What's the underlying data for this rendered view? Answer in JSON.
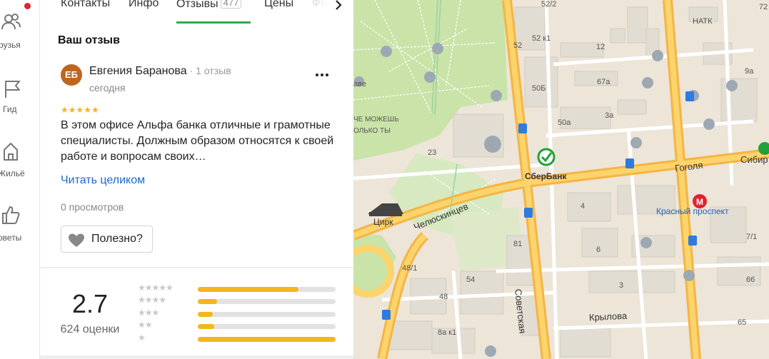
{
  "sidebar": {
    "items": [
      {
        "label": "рузья",
        "icon": "friends-icon",
        "has_notification": true
      },
      {
        "label": "Гид",
        "icon": "flag-icon"
      },
      {
        "label": "Жильё",
        "icon": "house-icon"
      },
      {
        "label": "оветы",
        "icon": "thumbs-up-icon"
      }
    ]
  },
  "tabs": [
    {
      "label": "Контакты"
    },
    {
      "label": "Инфо"
    },
    {
      "label": "Отзывы",
      "count": "477",
      "active": true
    },
    {
      "label": "Цены"
    },
    {
      "label": "Фо"
    }
  ],
  "your_review": {
    "section_title": "Ваш отзыв",
    "avatar_initials": "ЕБ",
    "author": "Евгения Баранова",
    "author_meta": "· 1 отзыв",
    "date": "сегодня",
    "stars": "★★★★★",
    "rating": 5,
    "text": "В этом офисе Альфа банка отличные и грамотные специалисты. Должным образом относятся к своей работе и вопросам своих…",
    "read_more": "Читать целиком",
    "views": "0 просмотров",
    "useful_label": "Полезно?"
  },
  "summary": {
    "rating": "2.7",
    "count": "624 оценки",
    "distribution": [
      {
        "stars": 5,
        "fraction": 0.73
      },
      {
        "stars": 4,
        "fraction": 0.14
      },
      {
        "stars": 3,
        "fraction": 0.11
      },
      {
        "stars": 2,
        "fraction": 0.12
      },
      {
        "stars": 1,
        "fraction": 1.0
      }
    ]
  },
  "colors": {
    "accent_green": "#34a853",
    "star_yellow": "#f6b51d",
    "link_blue": "#1d68c9",
    "avatar": "#c0651e",
    "notification": "#e0232e"
  },
  "map": {
    "labels": {
      "sberbank": "СберБанк",
      "gogolya": "Гоголя",
      "sibir": "Сибир",
      "krasny": "Красный проспект",
      "chelyuskintsev": "Челюскинцев",
      "sovetskaya": "Советская",
      "krylova": "Крылова",
      "tsirk": "Цирк",
      "natk": "НАТК",
      "ave": "аве",
      "mozhesh1": "ЧЕ МОЖЕШЬ",
      "mozhesh2": "ОЛЬКО ТЫ",
      "h52_2": "52/2",
      "h52k1": "52 к1",
      "h52": "52",
      "h12": "12",
      "h9a": "9а",
      "h50b": "50Б",
      "h67a": "67а",
      "h50a": "50а",
      "h3a": "3а",
      "h23": "23",
      "h4": "4",
      "h7_1": "7/1",
      "h81": "81",
      "h6": "6",
      "h48_1": "48/1",
      "h54": "54",
      "h48": "48",
      "h3": "3",
      "h66": "66",
      "h65": "65",
      "h8ak1": "8а к1",
      "h72": "72"
    }
  }
}
